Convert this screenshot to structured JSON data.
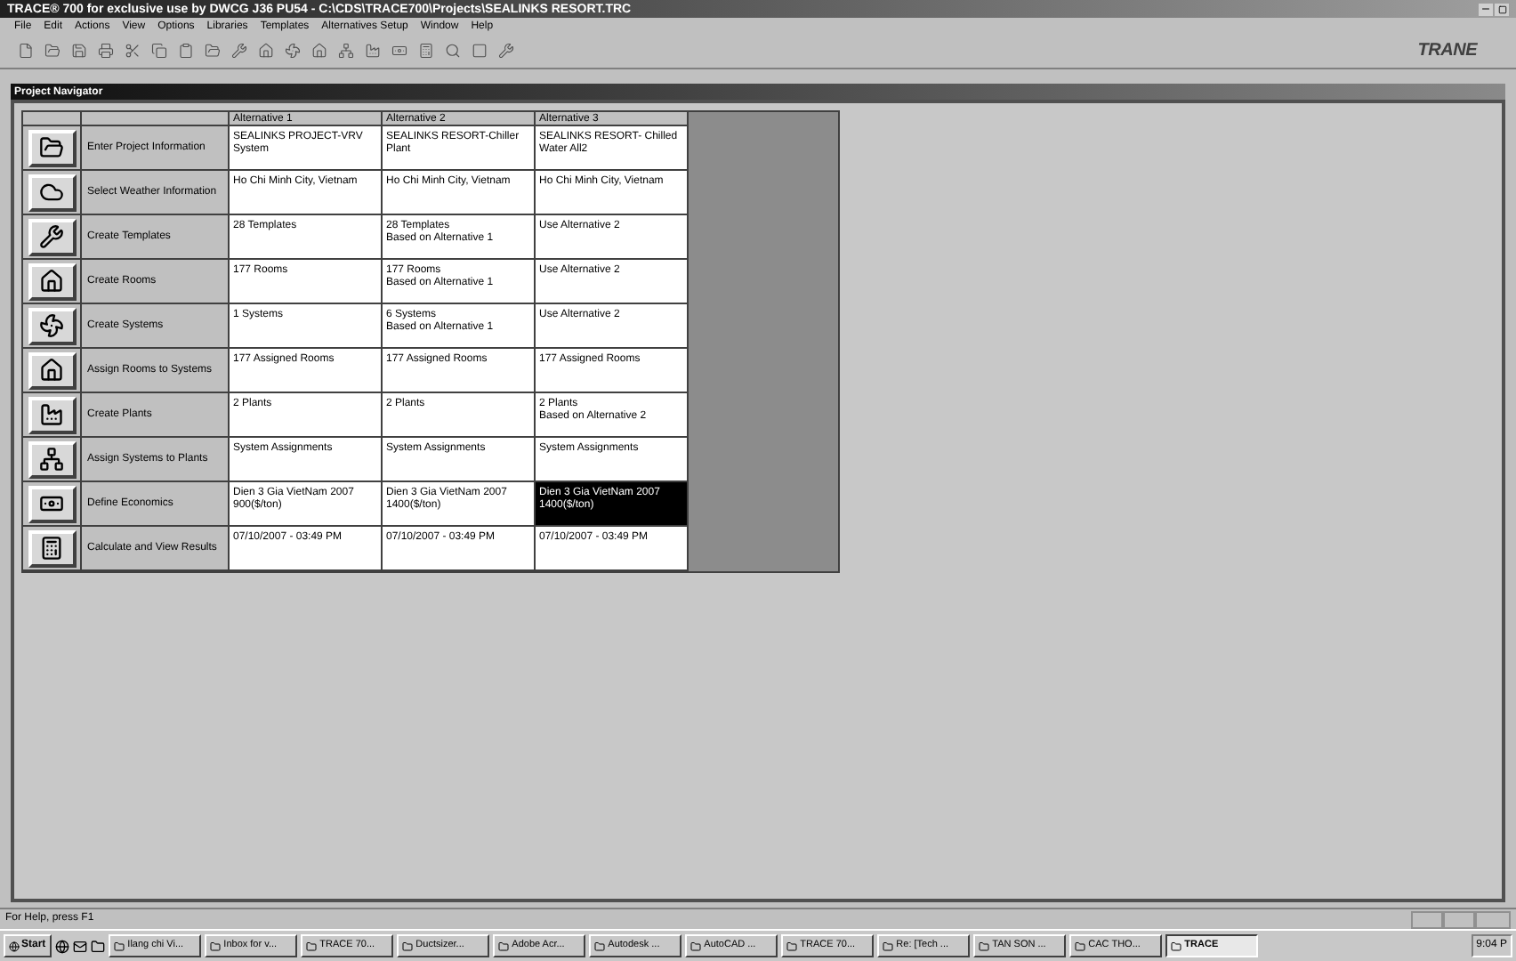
{
  "window": {
    "title": "TRACE® 700 for exclusive use by DWCG J36 PU54 - C:\\CDS\\TRACE700\\Projects\\SEALINKS RESORT.TRC"
  },
  "menu": [
    "File",
    "Edit",
    "Actions",
    "View",
    "Options",
    "Libraries",
    "Templates",
    "Alternatives Setup",
    "Window",
    "Help"
  ],
  "logo": "TRANE",
  "navigator": {
    "title": "Project Navigator",
    "columns": [
      "Alternative 1",
      "Alternative 2",
      "Alternative 3"
    ],
    "rows": [
      {
        "label": "Enter Project Information",
        "cells": [
          {
            "text": "SEALINKS PROJECT-VRV\nSystem",
            "selected": false
          },
          {
            "text": "SEALINKS RESORT-Chiller\nPlant",
            "selected": false
          },
          {
            "text": "SEALINKS RESORT- Chilled\nWater All2",
            "selected": false
          }
        ]
      },
      {
        "label": "Select Weather Information",
        "cells": [
          {
            "text": "Ho Chi Minh City, Vietnam",
            "selected": false
          },
          {
            "text": "Ho Chi Minh City, Vietnam",
            "selected": false
          },
          {
            "text": "Ho Chi Minh City, Vietnam",
            "selected": false
          }
        ]
      },
      {
        "label": "Create Templates",
        "cells": [
          {
            "text": "28 Templates",
            "selected": false
          },
          {
            "text": "28 Templates\nBased on Alternative 1",
            "selected": false
          },
          {
            "text": "Use Alternative 2",
            "selected": false
          }
        ]
      },
      {
        "label": "Create Rooms",
        "cells": [
          {
            "text": "177 Rooms",
            "selected": false
          },
          {
            "text": "177 Rooms\nBased on Alternative 1",
            "selected": false
          },
          {
            "text": "Use Alternative 2",
            "selected": false
          }
        ]
      },
      {
        "label": "Create Systems",
        "cells": [
          {
            "text": "1 Systems",
            "selected": false
          },
          {
            "text": "6 Systems\nBased on Alternative 1",
            "selected": false
          },
          {
            "text": "Use Alternative 2",
            "selected": false
          }
        ]
      },
      {
        "label": "Assign Rooms to Systems",
        "cells": [
          {
            "text": "177 Assigned Rooms",
            "selected": false
          },
          {
            "text": "177 Assigned Rooms",
            "selected": false
          },
          {
            "text": "177 Assigned Rooms",
            "selected": false
          }
        ]
      },
      {
        "label": "Create Plants",
        "cells": [
          {
            "text": "2 Plants",
            "selected": false
          },
          {
            "text": "2 Plants",
            "selected": false
          },
          {
            "text": "2 Plants\nBased on Alternative 2",
            "selected": false
          }
        ]
      },
      {
        "label": "Assign Systems to Plants",
        "cells": [
          {
            "text": "System Assignments",
            "selected": false
          },
          {
            "text": "System Assignments",
            "selected": false
          },
          {
            "text": "System Assignments",
            "selected": false
          }
        ]
      },
      {
        "label": "Define Economics",
        "cells": [
          {
            "text": "Dien 3 Gia VietNam 2007\n900($/ton)",
            "selected": false
          },
          {
            "text": "Dien 3 Gia VietNam 2007\n1400($/ton)",
            "selected": false
          },
          {
            "text": "Dien 3 Gia VietNam 2007\n1400($/ton)",
            "selected": true
          }
        ]
      },
      {
        "label": "Calculate and View Results",
        "cells": [
          {
            "text": "07/10/2007 - 03:49 PM",
            "selected": false
          },
          {
            "text": "07/10/2007 - 03:49 PM",
            "selected": false
          },
          {
            "text": "07/10/2007 - 03:49 PM",
            "selected": false
          }
        ]
      }
    ]
  },
  "status_bar": "For Help, press F1",
  "taskbar": {
    "start": "Start",
    "items": [
      {
        "label": "Ilang chi Vi...",
        "selected": false
      },
      {
        "label": "Inbox for v...",
        "selected": false
      },
      {
        "label": "TRACE 70...",
        "selected": false
      },
      {
        "label": "Ductsizer...",
        "selected": false
      },
      {
        "label": "Adobe Acr...",
        "selected": false
      },
      {
        "label": "Autodesk ...",
        "selected": false
      },
      {
        "label": "AutoCAD ...",
        "selected": false
      },
      {
        "label": "TRACE 70...",
        "selected": false
      },
      {
        "label": "Re: [Tech ...",
        "selected": false
      },
      {
        "label": "TAN SON ...",
        "selected": false
      },
      {
        "label": "CAC THO...",
        "selected": false
      },
      {
        "label": "TRACE",
        "selected": true
      }
    ],
    "clock": "9:04 P"
  }
}
